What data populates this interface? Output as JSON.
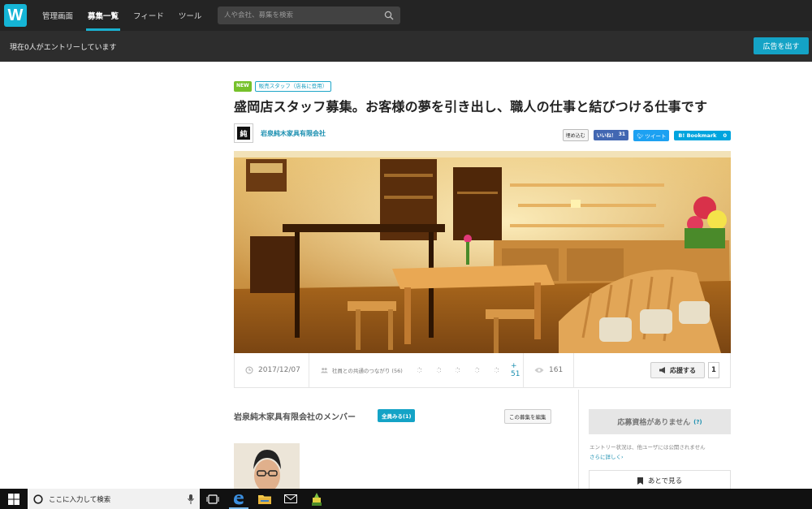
{
  "topnav": {
    "logo": "W",
    "links": [
      {
        "label": "管理画面",
        "active": false
      },
      {
        "label": "募集一覧",
        "active": true
      },
      {
        "label": "フィード",
        "active": false
      },
      {
        "label": "ツール",
        "active": false
      }
    ],
    "search_placeholder": "人や会社、募集を検索"
  },
  "subbar": {
    "entry_status": "現在0人がエントリーしています",
    "ad_button": "広告を出す"
  },
  "job": {
    "tag_new": "NEW",
    "tag_category": "販売スタッフ（店長に登用）",
    "title": "盛岡店スタッフ募集。お客様の夢を引き出し、職人の仕事と結びつける仕事です",
    "company_name": "岩泉純木家具有限会社",
    "company_logo_text": "純"
  },
  "social": {
    "embed": "埋め込む",
    "like_label": "いいね！",
    "like_count": "31",
    "tweet": "ツイート",
    "bookmark_label": "B! Bookmark",
    "bookmark_count": "0"
  },
  "meta": {
    "date": "2017/12/07",
    "connections_label": "社員との共通のつながり (56)",
    "connections_more": "+ 51",
    "views": "161",
    "support_label": "応援する",
    "support_count": "1"
  },
  "members": {
    "title": "岩泉純木家具有限会社のメンバー",
    "view_all": "全員みる(1)",
    "edit": "この募集を編集"
  },
  "apply": {
    "status": "応募資格がありません",
    "help": "(?)",
    "note_line1": "エントリー状況は、他ユーザには公開されません",
    "note_link": "さらに詳しく›",
    "later": "あとで見る"
  },
  "taskbar": {
    "search_text": "ここに入力して検索"
  },
  "colors": {
    "accent": "#14a3c6",
    "nav_bg": "#242424",
    "subbar_bg": "#2d2d2d",
    "new_tag": "#76c12b",
    "facebook": "#4267b2",
    "twitter": "#1da1f2",
    "hatena": "#00a4de"
  }
}
